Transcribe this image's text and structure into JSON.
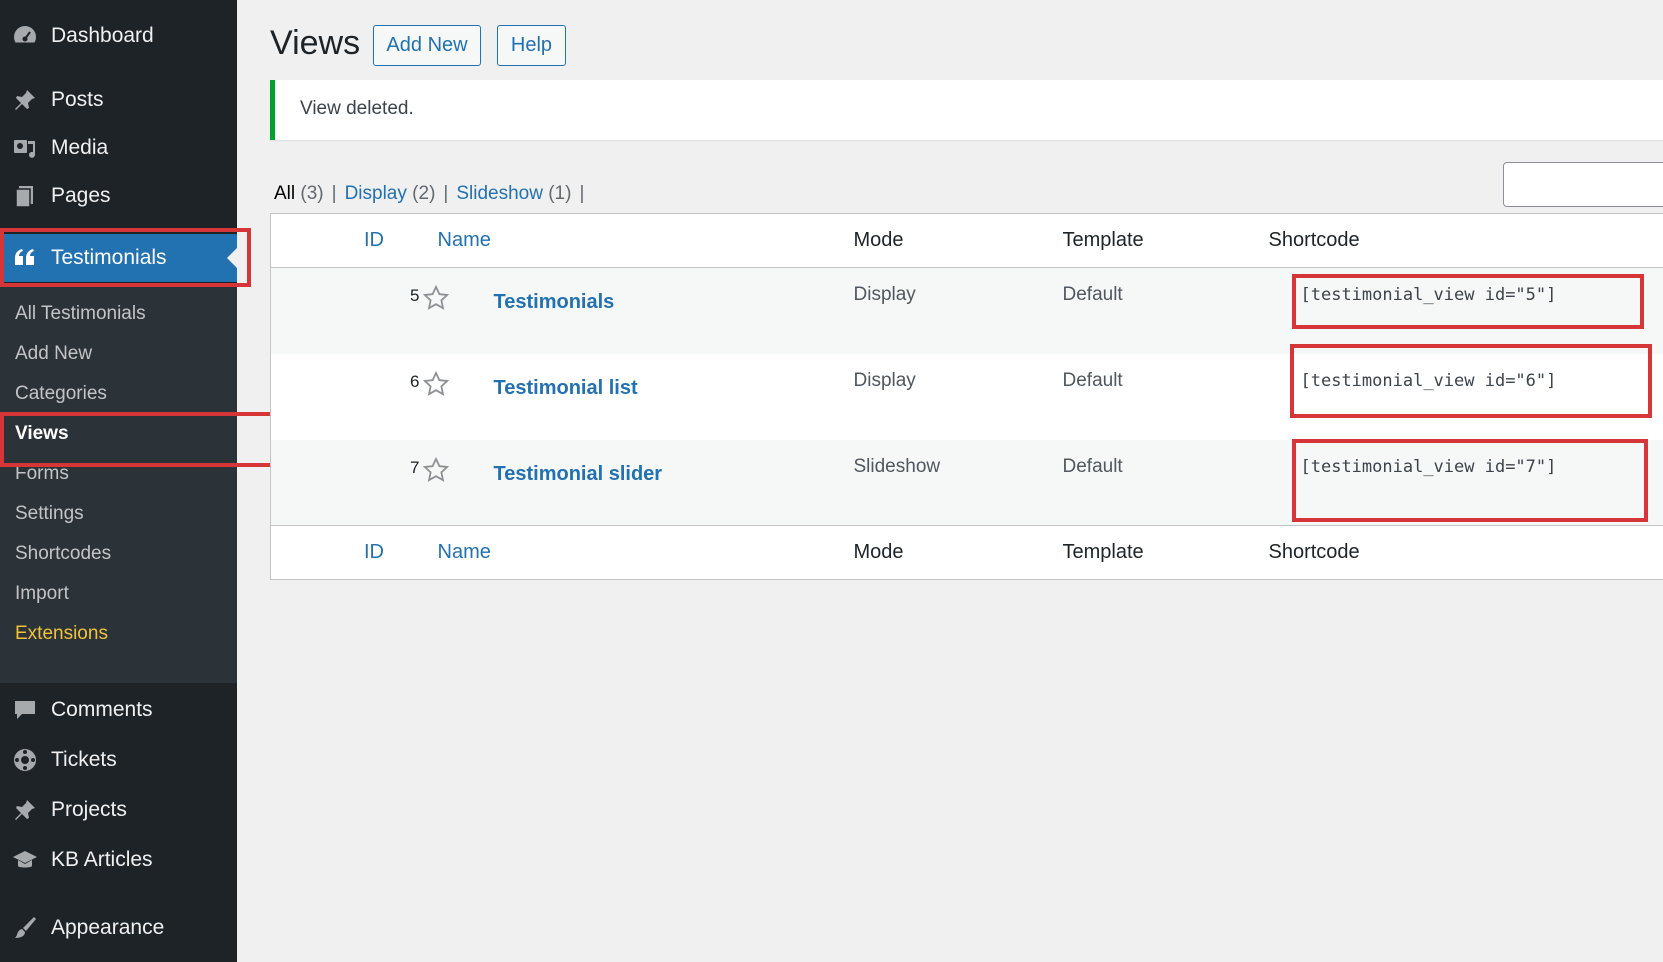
{
  "sidebar": {
    "top_items": [
      {
        "label": "Dashboard",
        "icon": "dashboard-icon"
      },
      {
        "label": "Posts",
        "icon": "pin-icon"
      },
      {
        "label": "Media",
        "icon": "media-icon"
      },
      {
        "label": "Pages",
        "icon": "pages-icon"
      },
      {
        "label": "Testimonials",
        "icon": "quote-icon"
      }
    ],
    "submenu": [
      "All Testimonials",
      "Add New",
      "Categories",
      "Views",
      "Forms",
      "Settings",
      "Shortcodes",
      "Import",
      "Extensions"
    ],
    "bottom_items": [
      {
        "label": "Comments",
        "icon": "comments-icon"
      },
      {
        "label": "Tickets",
        "icon": "tickets-icon"
      },
      {
        "label": "Projects",
        "icon": "pin-icon"
      },
      {
        "label": "KB Articles",
        "icon": "graduation-cap-icon"
      },
      {
        "label": "Appearance",
        "icon": "paintbrush-icon"
      }
    ],
    "accent_color": "#2271b1",
    "highlight_color": "#d63638"
  },
  "header": {
    "title": "Views",
    "add_new_label": "Add New",
    "help_label": "Help"
  },
  "notice": {
    "text": "View deleted.",
    "color": "#00a32a"
  },
  "filters": {
    "all_label": "All",
    "all_count": "(3)",
    "display_label": "Display",
    "display_count": "(2)",
    "slideshow_label": "Slideshow",
    "slideshow_count": "(1)",
    "separator": "|"
  },
  "table": {
    "columns": [
      "ID",
      "Name",
      "Mode",
      "Template",
      "Shortcode"
    ],
    "rows": [
      {
        "id": "5",
        "name": "Testimonials",
        "mode": "Display",
        "template": "Default",
        "shortcode": "[testimonial_view id=\"5\"]"
      },
      {
        "id": "6",
        "name": "Testimonial list",
        "mode": "Display",
        "template": "Default",
        "shortcode": "[testimonial_view id=\"6\"]"
      },
      {
        "id": "7",
        "name": "Testimonial slider",
        "mode": "Slideshow",
        "template": "Default",
        "shortcode": "[testimonial_view id=\"7\"]"
      }
    ]
  }
}
